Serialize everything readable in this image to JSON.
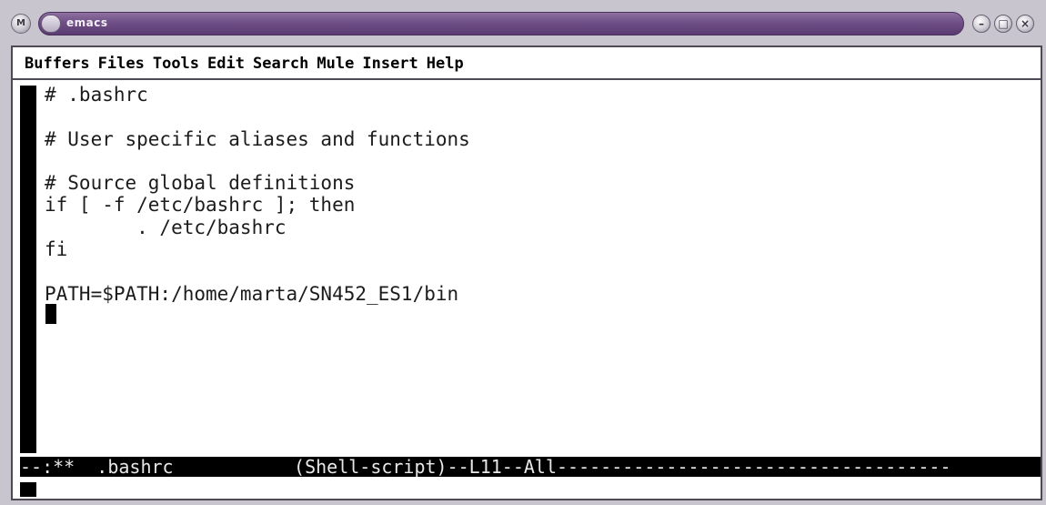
{
  "window": {
    "title": "emacs",
    "menu_button_glyph": "M",
    "controls": {
      "minimize_glyph": "–",
      "maximize_glyph": "□",
      "close_glyph": "×"
    }
  },
  "menubar": {
    "items": [
      "Buffers",
      "Files",
      "Tools",
      "Edit",
      "Search",
      "Mule",
      "Insert",
      "Help"
    ]
  },
  "buffer": {
    "lines": [
      "# .bashrc",
      "",
      "# User specific aliases and functions",
      "",
      "# Source global definitions",
      "if [ -f /etc/bashrc ]; then",
      "        . /etc/bashrc",
      "fi",
      "",
      "PATH=$PATH:/home/marta/SN452_ES1/bin"
    ]
  },
  "modeline": {
    "text": "--:**  .bashrc           (Shell-script)--L11--All------------------------------------"
  },
  "colors": {
    "title_bar": "#6f4f86",
    "frame_border": "#4e4a55",
    "background": "#ffffff",
    "modeline_bg": "#000000"
  }
}
